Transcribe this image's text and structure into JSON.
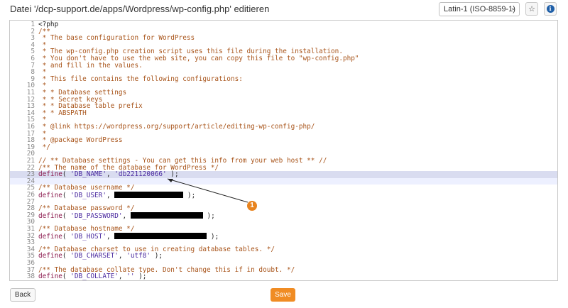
{
  "header": {
    "title": "Datei '/dcp-support.de/apps/Wordpress/wp-config.php' editieren",
    "encoding": "Latin-1 (ISO-8859-1)",
    "star_icon": "star-icon",
    "info_icon": "info-icon",
    "info_glyph": "i"
  },
  "editor": {
    "lines": [
      {
        "n": "1",
        "t": "<?php",
        "k": "plain"
      },
      {
        "n": "2",
        "t": "/**",
        "k": "comment"
      },
      {
        "n": "3",
        "t": " * The base configuration for WordPress",
        "k": "comment"
      },
      {
        "n": "4",
        "t": " *",
        "k": "comment"
      },
      {
        "n": "5",
        "t": " * The wp-config.php creation script uses this file during the installation.",
        "k": "comment"
      },
      {
        "n": "6",
        "t": " * You don't have to use the web site, you can copy this file to \"wp-config.php\"",
        "k": "comment"
      },
      {
        "n": "7",
        "t": " * and fill in the values.",
        "k": "comment"
      },
      {
        "n": "8",
        "t": " *",
        "k": "comment"
      },
      {
        "n": "9",
        "t": " * This file contains the following configurations:",
        "k": "comment"
      },
      {
        "n": "10",
        "t": " *",
        "k": "comment"
      },
      {
        "n": "11",
        "t": " * * Database settings",
        "k": "comment"
      },
      {
        "n": "12",
        "t": " * * Secret keys",
        "k": "comment"
      },
      {
        "n": "13",
        "t": " * * Database table prefix",
        "k": "comment"
      },
      {
        "n": "14",
        "t": " * * ABSPATH",
        "k": "comment"
      },
      {
        "n": "15",
        "t": " *",
        "k": "comment"
      },
      {
        "n": "16",
        "t": " * @link https://wordpress.org/support/article/editing-wp-config-php/",
        "k": "comment"
      },
      {
        "n": "17",
        "t": " *",
        "k": "comment"
      },
      {
        "n": "18",
        "t": " * @package WordPress",
        "k": "comment"
      },
      {
        "n": "19",
        "t": " */",
        "k": "comment"
      },
      {
        "n": "20",
        "t": "",
        "k": "plain"
      },
      {
        "n": "21",
        "t": "// ** Database settings - You can get this info from your web host ** //",
        "k": "comment"
      },
      {
        "n": "22",
        "t": "/** The name of the database for WordPress */",
        "k": "comment"
      },
      {
        "n": "23",
        "k": "define",
        "key": "'DB_NAME'",
        "val": "'db221120066'",
        "tail": " );",
        "hl": "hl"
      },
      {
        "n": "24",
        "t": "",
        "k": "plain",
        "hl": "hl2"
      },
      {
        "n": "25",
        "t": "/** Database username */",
        "k": "comment"
      },
      {
        "n": "26",
        "k": "define",
        "key": "'DB_USER'",
        "redact": 97,
        "tail": " );"
      },
      {
        "n": "27",
        "t": "",
        "k": "plain"
      },
      {
        "n": "28",
        "t": "/** Database password */",
        "k": "comment"
      },
      {
        "n": "29",
        "k": "define",
        "key": "'DB_PASSWORD'",
        "redact": 102,
        "tail": " );"
      },
      {
        "n": "30",
        "t": "",
        "k": "plain"
      },
      {
        "n": "31",
        "t": "/** Database hostname */",
        "k": "comment"
      },
      {
        "n": "32",
        "k": "define",
        "key": "'DB_HOST'",
        "redact": 130,
        "tail": " );"
      },
      {
        "n": "33",
        "t": "",
        "k": "plain"
      },
      {
        "n": "34",
        "t": "/** Database charset to use in creating database tables. */",
        "k": "comment"
      },
      {
        "n": "35",
        "k": "define",
        "key": "'DB_CHARSET'",
        "val": "'utf8'",
        "tail": " );"
      },
      {
        "n": "36",
        "t": "",
        "k": "plain"
      },
      {
        "n": "37",
        "t": "/** The database collate type. Don't change this if in doubt. */",
        "k": "comment"
      },
      {
        "n": "38",
        "k": "define",
        "key": "'DB_COLLATE'",
        "val": "''",
        "tail": " );"
      }
    ]
  },
  "annotation": {
    "number": "1"
  },
  "footer": {
    "back_label": "Back",
    "save_label": "Save"
  },
  "colors": {
    "save": "#f08c24",
    "highlight": "#d9dcf0",
    "comment": "#a8541a",
    "badge": "#e8841f"
  }
}
